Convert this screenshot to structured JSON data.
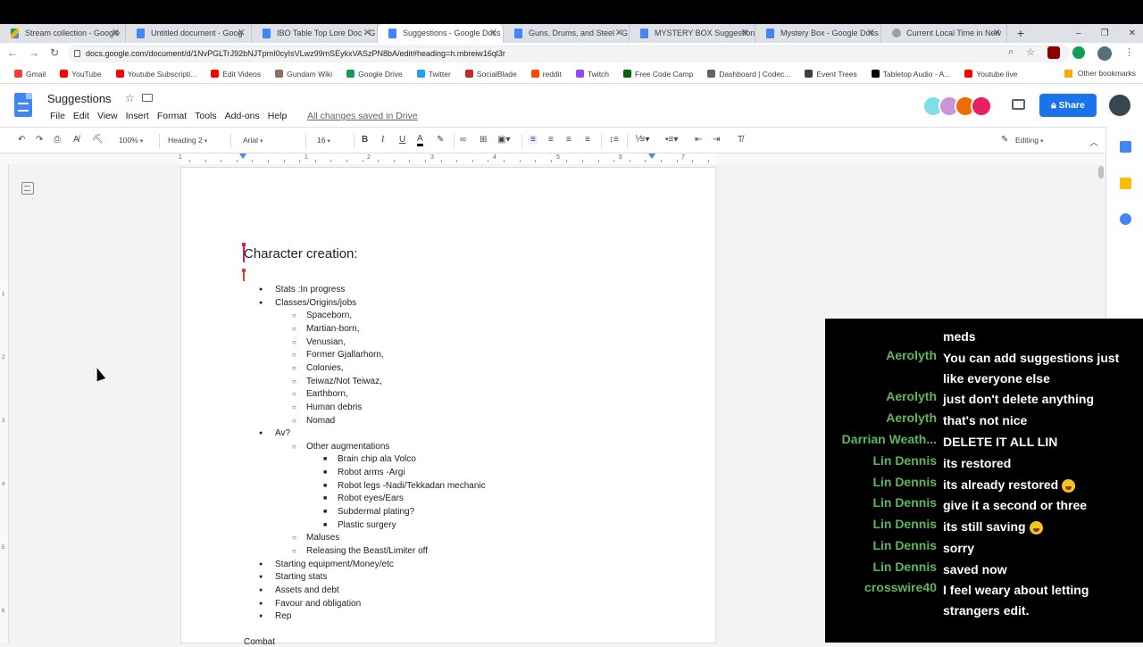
{
  "browser": {
    "tabs": [
      {
        "label": "Stream collection - Google",
        "icon": "drive-icon",
        "active": false
      },
      {
        "label": "Untitled document - Goog",
        "icon": "docs-icon",
        "active": false
      },
      {
        "label": "IBO Table Top Lore Doc - G",
        "icon": "docs-icon",
        "active": false
      },
      {
        "label": "Suggestions - Google Docs",
        "icon": "docs-icon",
        "active": true
      },
      {
        "label": "Guns, Drums, and Steel - G",
        "icon": "docs-icon",
        "active": false
      },
      {
        "label": "MYSTERY BOX Suggestions",
        "icon": "docs-icon",
        "active": false
      },
      {
        "label": "Mystery Box - Google Docs",
        "icon": "docs-icon",
        "active": false
      },
      {
        "label": "Current Local Time in New",
        "icon": "globe-icon",
        "active": false
      }
    ],
    "newtab": "+",
    "tab_close": "✕",
    "window_controls": {
      "minimize": "–",
      "maximize": "❐",
      "close": "✕"
    },
    "url": "docs.google.com/document/d/1NvPGLTrJ92bNJTpmI0cyIsVLwz99mSEykxVASzPN8bA/edit#heading=h.mbreiw16ql3r",
    "nav": {
      "back": "←",
      "forward": "→",
      "reload": "↻"
    },
    "bookmarks": [
      {
        "label": "Gmail",
        "color": "#ea4335"
      },
      {
        "label": "YouTube",
        "color": "#ff0000"
      },
      {
        "label": "Youtube Subscripti...",
        "color": "#ff0000"
      },
      {
        "label": "Edit Videos",
        "color": "#ff0000"
      },
      {
        "label": "Gundam Wiki",
        "color": "#8d6e63"
      },
      {
        "label": "Google Drive",
        "color": "#0f9d58"
      },
      {
        "label": "Twitter",
        "color": "#1da1f2"
      },
      {
        "label": "SocialBlade",
        "color": "#c62828"
      },
      {
        "label": "reddit",
        "color": "#ff4500"
      },
      {
        "label": "Twitch",
        "color": "#9146ff"
      },
      {
        "label": "Free Code Camp",
        "color": "#006400"
      },
      {
        "label": "Dashboard | Codec...",
        "color": "#5f6368"
      },
      {
        "label": "Event Trees",
        "color": "#3c4043"
      },
      {
        "label": "Tabletop Audio - A...",
        "color": "#000000"
      },
      {
        "label": "Youtube live",
        "color": "#ff0000"
      }
    ],
    "other_bookmarks": "Other bookmarks"
  },
  "docs": {
    "title": "Suggestions",
    "menu": [
      "File",
      "Edit",
      "View",
      "Insert",
      "Format",
      "Tools",
      "Add-ons",
      "Help"
    ],
    "saved_status": "All changes saved in Drive",
    "share_label": "Share",
    "toolbar": {
      "zoom": "100%",
      "style": "Heading 2",
      "font": "Arial",
      "size": "16",
      "mode": "Editing"
    },
    "ruler_numbers": [
      "1",
      "1",
      "2",
      "3",
      "4",
      "5",
      "6",
      "7"
    ],
    "vruler_numbers": [
      "1",
      "2",
      "3",
      "4",
      "5",
      "6"
    ],
    "accent_color": "#1a73e8"
  },
  "document": {
    "heading": "Character creation:",
    "items": [
      {
        "level": 1,
        "text": "Stats :In progress"
      },
      {
        "level": 1,
        "text": "Classes/Origins/jobs"
      },
      {
        "level": 2,
        "text": "Spaceborn,"
      },
      {
        "level": 2,
        "text": "Martian-born,"
      },
      {
        "level": 2,
        "text": "Venusian,"
      },
      {
        "level": 2,
        "text": "Former Gjallarhorn,"
      },
      {
        "level": 2,
        "text": "Colonies,"
      },
      {
        "level": 2,
        "text": "Teiwaz/Not Teiwaz,"
      },
      {
        "level": 2,
        "text": "Earthborn,"
      },
      {
        "level": 2,
        "text": "Human debris"
      },
      {
        "level": 2,
        "text": "Nomad"
      },
      {
        "level": 1,
        "text": "Av?"
      },
      {
        "level": 2,
        "text": "Other augmentations"
      },
      {
        "level": 3,
        "text": "Brain chip ala Volco"
      },
      {
        "level": 3,
        "text": "Robot arms -Argi"
      },
      {
        "level": 3,
        "text": "Robot legs -Nadi/Tekkadan mechanic"
      },
      {
        "level": 3,
        "text": "Robot eyes/Ears"
      },
      {
        "level": 3,
        "text": "Subdermal plating?"
      },
      {
        "level": 3,
        "text": "Plastic surgery"
      },
      {
        "level": 2,
        "text": "Maluses"
      },
      {
        "level": 2,
        "text": "Releasing the Beast/Limiter off"
      },
      {
        "level": 1,
        "text": "Starting equipment/Money/etc"
      },
      {
        "level": 1,
        "text": "Starting stats"
      },
      {
        "level": 1,
        "text": "Assets and debt"
      },
      {
        "level": 1,
        "text": "Favour and obligation"
      },
      {
        "level": 1,
        "text": "Rep"
      }
    ],
    "next_heading": "Combat"
  },
  "chat": {
    "name_color": "#5cb85c",
    "messages": [
      {
        "user": "",
        "text": "meds",
        "emoji": false
      },
      {
        "user": "Aerolyth",
        "text": "You can add suggestions just like everyone else",
        "emoji": false
      },
      {
        "user": "Aerolyth",
        "text": "just don't delete anything",
        "emoji": false
      },
      {
        "user": "Aerolyth",
        "text": "that's not nice",
        "emoji": false
      },
      {
        "user": "Darrian Weath...",
        "text": "DELETE IT ALL LIN",
        "emoji": false
      },
      {
        "user": "Lin Dennis",
        "text": "its restored",
        "emoji": false
      },
      {
        "user": "Lin Dennis",
        "text": "its already restored",
        "emoji": true
      },
      {
        "user": "Lin Dennis",
        "text": "give it a second or three",
        "emoji": false
      },
      {
        "user": "Lin Dennis",
        "text": "its still saving",
        "emoji": true
      },
      {
        "user": "Lin Dennis",
        "text": "sorry",
        "emoji": false
      },
      {
        "user": "Lin Dennis",
        "text": "saved now",
        "emoji": false
      },
      {
        "user": "crosswire40",
        "text": "I feel weary about letting strangers edit.",
        "emoji": false
      }
    ]
  }
}
